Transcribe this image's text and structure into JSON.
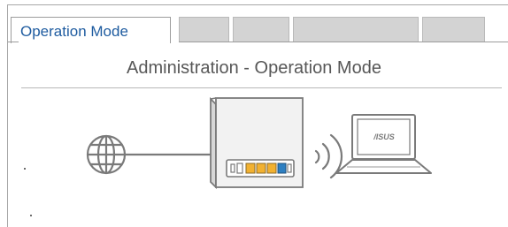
{
  "tabs": {
    "active_label": "Operation Mode",
    "inactive_count": 4
  },
  "page": {
    "title": "Administration - Operation Mode"
  },
  "illustration": {
    "laptop_logo": "/ISUS",
    "icons": [
      "globe-icon",
      "router-icon",
      "wifi-signal-icon",
      "laptop-icon"
    ],
    "colors": {
      "stroke": "#7a7a7a",
      "router_face": "#f2f2f2",
      "router_side": "#d7d7d7",
      "port_yellow": "#f2b130",
      "port_blue": "#2d7fc1"
    }
  }
}
